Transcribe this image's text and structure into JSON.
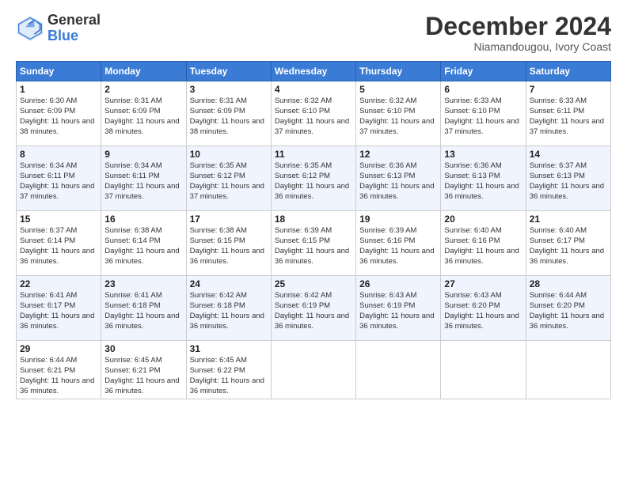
{
  "logo": {
    "general": "General",
    "blue": "Blue"
  },
  "header": {
    "month": "December 2024",
    "location": "Niamandougou, Ivory Coast"
  },
  "weekdays": [
    "Sunday",
    "Monday",
    "Tuesday",
    "Wednesday",
    "Thursday",
    "Friday",
    "Saturday"
  ],
  "weeks": [
    [
      {
        "day": "1",
        "sunrise": "6:30 AM",
        "sunset": "6:09 PM",
        "daylight": "11 hours and 38 minutes."
      },
      {
        "day": "2",
        "sunrise": "6:31 AM",
        "sunset": "6:09 PM",
        "daylight": "11 hours and 38 minutes."
      },
      {
        "day": "3",
        "sunrise": "6:31 AM",
        "sunset": "6:09 PM",
        "daylight": "11 hours and 38 minutes."
      },
      {
        "day": "4",
        "sunrise": "6:32 AM",
        "sunset": "6:10 PM",
        "daylight": "11 hours and 37 minutes."
      },
      {
        "day": "5",
        "sunrise": "6:32 AM",
        "sunset": "6:10 PM",
        "daylight": "11 hours and 37 minutes."
      },
      {
        "day": "6",
        "sunrise": "6:33 AM",
        "sunset": "6:10 PM",
        "daylight": "11 hours and 37 minutes."
      },
      {
        "day": "7",
        "sunrise": "6:33 AM",
        "sunset": "6:11 PM",
        "daylight": "11 hours and 37 minutes."
      }
    ],
    [
      {
        "day": "8",
        "sunrise": "6:34 AM",
        "sunset": "6:11 PM",
        "daylight": "11 hours and 37 minutes."
      },
      {
        "day": "9",
        "sunrise": "6:34 AM",
        "sunset": "6:11 PM",
        "daylight": "11 hours and 37 minutes."
      },
      {
        "day": "10",
        "sunrise": "6:35 AM",
        "sunset": "6:12 PM",
        "daylight": "11 hours and 37 minutes."
      },
      {
        "day": "11",
        "sunrise": "6:35 AM",
        "sunset": "6:12 PM",
        "daylight": "11 hours and 36 minutes."
      },
      {
        "day": "12",
        "sunrise": "6:36 AM",
        "sunset": "6:13 PM",
        "daylight": "11 hours and 36 minutes."
      },
      {
        "day": "13",
        "sunrise": "6:36 AM",
        "sunset": "6:13 PM",
        "daylight": "11 hours and 36 minutes."
      },
      {
        "day": "14",
        "sunrise": "6:37 AM",
        "sunset": "6:13 PM",
        "daylight": "11 hours and 36 minutes."
      }
    ],
    [
      {
        "day": "15",
        "sunrise": "6:37 AM",
        "sunset": "6:14 PM",
        "daylight": "11 hours and 36 minutes."
      },
      {
        "day": "16",
        "sunrise": "6:38 AM",
        "sunset": "6:14 PM",
        "daylight": "11 hours and 36 minutes."
      },
      {
        "day": "17",
        "sunrise": "6:38 AM",
        "sunset": "6:15 PM",
        "daylight": "11 hours and 36 minutes."
      },
      {
        "day": "18",
        "sunrise": "6:39 AM",
        "sunset": "6:15 PM",
        "daylight": "11 hours and 36 minutes."
      },
      {
        "day": "19",
        "sunrise": "6:39 AM",
        "sunset": "6:16 PM",
        "daylight": "11 hours and 36 minutes."
      },
      {
        "day": "20",
        "sunrise": "6:40 AM",
        "sunset": "6:16 PM",
        "daylight": "11 hours and 36 minutes."
      },
      {
        "day": "21",
        "sunrise": "6:40 AM",
        "sunset": "6:17 PM",
        "daylight": "11 hours and 36 minutes."
      }
    ],
    [
      {
        "day": "22",
        "sunrise": "6:41 AM",
        "sunset": "6:17 PM",
        "daylight": "11 hours and 36 minutes."
      },
      {
        "day": "23",
        "sunrise": "6:41 AM",
        "sunset": "6:18 PM",
        "daylight": "11 hours and 36 minutes."
      },
      {
        "day": "24",
        "sunrise": "6:42 AM",
        "sunset": "6:18 PM",
        "daylight": "11 hours and 36 minutes."
      },
      {
        "day": "25",
        "sunrise": "6:42 AM",
        "sunset": "6:19 PM",
        "daylight": "11 hours and 36 minutes."
      },
      {
        "day": "26",
        "sunrise": "6:43 AM",
        "sunset": "6:19 PM",
        "daylight": "11 hours and 36 minutes."
      },
      {
        "day": "27",
        "sunrise": "6:43 AM",
        "sunset": "6:20 PM",
        "daylight": "11 hours and 36 minutes."
      },
      {
        "day": "28",
        "sunrise": "6:44 AM",
        "sunset": "6:20 PM",
        "daylight": "11 hours and 36 minutes."
      }
    ],
    [
      {
        "day": "29",
        "sunrise": "6:44 AM",
        "sunset": "6:21 PM",
        "daylight": "11 hours and 36 minutes."
      },
      {
        "day": "30",
        "sunrise": "6:45 AM",
        "sunset": "6:21 PM",
        "daylight": "11 hours and 36 minutes."
      },
      {
        "day": "31",
        "sunrise": "6:45 AM",
        "sunset": "6:22 PM",
        "daylight": "11 hours and 36 minutes."
      },
      null,
      null,
      null,
      null
    ]
  ]
}
